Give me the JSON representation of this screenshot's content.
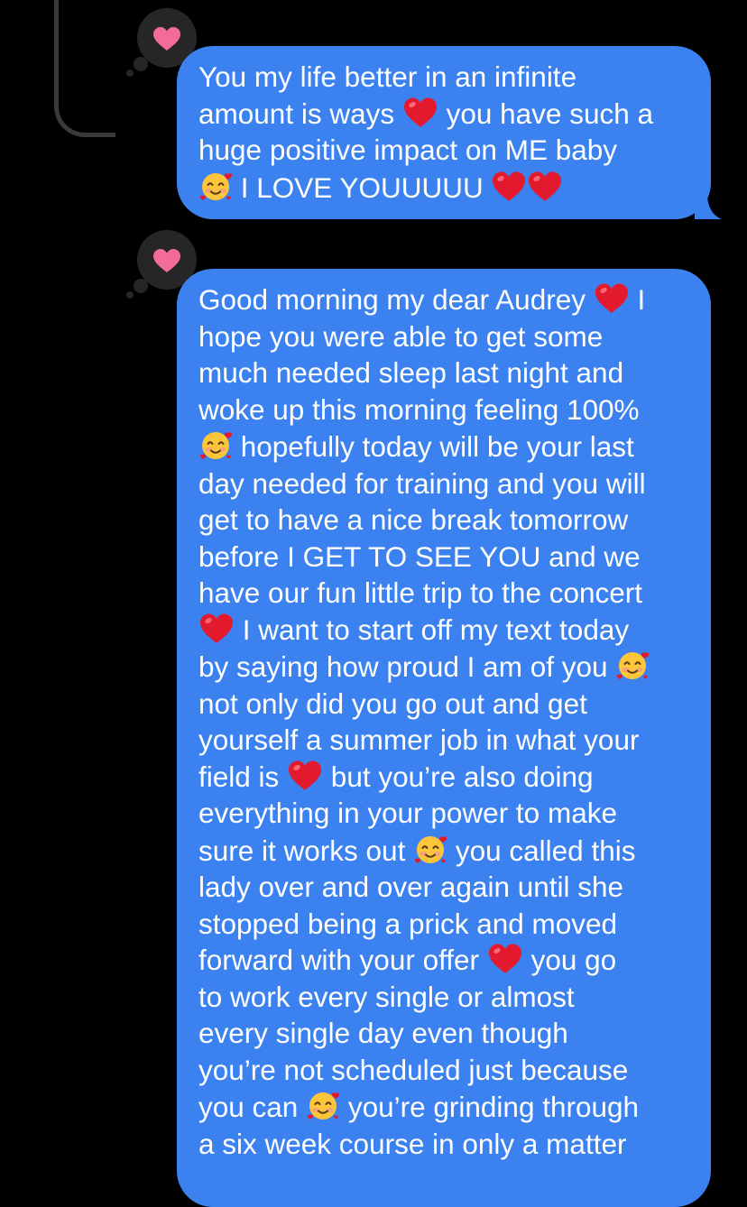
{
  "colors": {
    "background": "#000000",
    "bubble_sent": "#3b82f0",
    "text": "#ffffff",
    "tapback_bubble": "#262628",
    "tapback_heart": "#f36b9a",
    "emoji_heart": "#e3192e"
  },
  "messages": [
    {
      "reaction": "heart-icon",
      "lines": [
        "You my life better in an infinite",
        [
          "amount is ways ",
          "red-heart-emoji",
          " you have such a"
        ],
        "huge positive impact on ME baby",
        [
          "smiling-face-with-hearts-emoji",
          " I LOVE YOUUUUU ",
          "red-heart-emoji",
          "red-heart-emoji"
        ]
      ]
    },
    {
      "reaction": "heart-icon",
      "lines": [
        [
          "Good morning my dear Audrey ",
          "red-heart-emoji",
          " I"
        ],
        "hope you were able to get some",
        "much needed sleep last night and",
        "woke up this morning feeling 100%",
        [
          "smiling-face-with-hearts-emoji",
          " hopefully today will be your last"
        ],
        "day needed for training and you will",
        "get to have a nice break tomorrow",
        "before I GET TO SEE YOU and we",
        "have our fun little trip to the concert",
        [
          "red-heart-emoji",
          " I want to start off my text today"
        ],
        [
          "by saying how proud I am of you ",
          "smiling-face-with-hearts-emoji"
        ],
        "not only did you go out and get",
        "yourself a summer job in what your",
        [
          "field is ",
          "red-heart-emoji",
          " but you’re also doing"
        ],
        "everything in your power to make",
        [
          "sure it works out ",
          "smiling-face-with-hearts-emoji",
          " you called this"
        ],
        "lady over and over again until she",
        "stopped being a prick and moved",
        [
          "forward with your offer ",
          "red-heart-emoji",
          " you go"
        ],
        "to work every single or almost",
        "every single day even though",
        "you’re not scheduled just because",
        [
          "you can ",
          "smiling-face-with-hearts-emoji",
          " you’re grinding through"
        ],
        "a six week course in only a matter"
      ]
    }
  ]
}
